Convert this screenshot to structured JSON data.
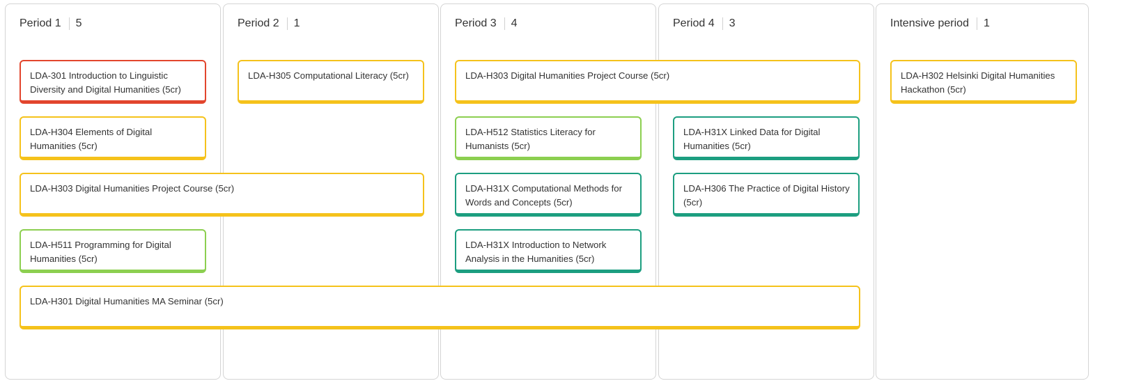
{
  "colors": {
    "red": "#e2452d",
    "yellow": "#f5c21b",
    "light_green": "#8ccf50",
    "teal": "#1c9e80"
  },
  "periods": [
    {
      "label": "Period 1",
      "count": "5"
    },
    {
      "label": "Period 2",
      "count": "1"
    },
    {
      "label": "Period 3",
      "count": "4"
    },
    {
      "label": "Period 4",
      "count": "3"
    },
    {
      "label": "Intensive period",
      "count": "1"
    }
  ],
  "courses": {
    "lda301": "LDA-301 Introduction to Linguistic Diversity and Digital Humanities (5cr)",
    "h304": "LDA-H304 Elements of Digital Humanities (5cr)",
    "h303_p12": "LDA-H303 Digital Humanities Project Course (5cr)",
    "h511": "LDA-H511 Programming for Digital Humanities (5cr)",
    "h301": "LDA-H301 Digital Humanities MA Seminar (5cr)",
    "h305": "LDA-H305 Computational Literacy (5cr)",
    "h303_p34": "LDA-H303 Digital Humanities Project Course (5cr)",
    "h512": "LDA-H512 Statistics Literacy for Humanists (5cr)",
    "h31x_methods": "LDA-H31X Computational Methods for Words and Concepts (5cr)",
    "h31x_network": "LDA-H31X Introduction to Network Analysis in the Humanities (5cr)",
    "h31x_linked": "LDA-H31X Linked Data for Digital Humanities (5cr)",
    "h306": "LDA-H306 The Practice of Digital History (5cr)",
    "h302": "LDA-H302 Helsinki Digital Humanities Hackathon (5cr)"
  }
}
